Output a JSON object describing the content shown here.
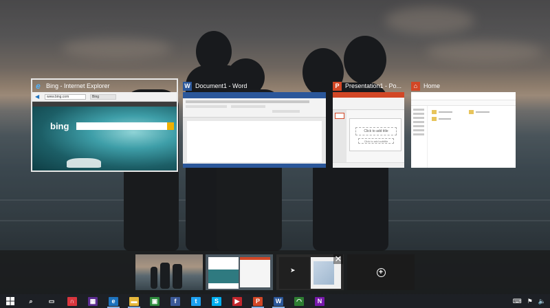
{
  "windows": [
    {
      "title": "Bing - Internet Explorer",
      "app": "internet-explorer",
      "icon_letter": "e",
      "color": "#1e73be",
      "selected": true
    },
    {
      "title": "Document1 - Word",
      "app": "word",
      "icon_letter": "W",
      "color": "#2b579a",
      "selected": false
    },
    {
      "title": "Presentation1 - Po...",
      "app": "powerpoint",
      "icon_letter": "P",
      "color": "#d24726",
      "selected": false
    },
    {
      "title": "Home",
      "app": "file-explorer",
      "icon_letter": "⌂",
      "color": "#d24726",
      "selected": false
    }
  ],
  "ie": {
    "address": "www.bing.com",
    "tab": "Bing",
    "logo": "bing"
  },
  "ppt": {
    "title_placeholder": "Click to add title",
    "subtitle_placeholder": "Click to add subtitle"
  },
  "desktops": {
    "count": 3,
    "add_icon": "+",
    "close_icon": "✕"
  },
  "taskbar": {
    "start_icon": "windows-logo",
    "items": [
      {
        "name": "search",
        "glyph": "⌕",
        "color": "#1d2025",
        "running": false
      },
      {
        "name": "task-view",
        "glyph": "▭",
        "color": "#1d2025",
        "running": false
      },
      {
        "name": "headphones",
        "glyph": "∩",
        "color": "#d9363e",
        "running": false
      },
      {
        "name": "app-purple",
        "glyph": "▦",
        "color": "#5c2d91",
        "running": false
      },
      {
        "name": "internet-explorer",
        "glyph": "e",
        "color": "#1e73be",
        "running": true
      },
      {
        "name": "file-explorer",
        "glyph": "▬",
        "color": "#e7b83c",
        "running": true
      },
      {
        "name": "store",
        "glyph": "▣",
        "color": "#2e8b3d",
        "running": false
      },
      {
        "name": "facebook",
        "glyph": "f",
        "color": "#3b5998",
        "running": false
      },
      {
        "name": "twitter",
        "glyph": "t",
        "color": "#1da1f2",
        "running": false
      },
      {
        "name": "skype",
        "glyph": "S",
        "color": "#00aff0",
        "running": false
      },
      {
        "name": "video",
        "glyph": "▶",
        "color": "#c1272d",
        "running": false
      },
      {
        "name": "powerpoint",
        "glyph": "P",
        "color": "#d24726",
        "running": true
      },
      {
        "name": "word",
        "glyph": "W",
        "color": "#2b579a",
        "running": true
      },
      {
        "name": "green-app",
        "glyph": "◠",
        "color": "#2e7d32",
        "running": false
      },
      {
        "name": "onenote",
        "glyph": "N",
        "color": "#7719aa",
        "running": false
      }
    ]
  }
}
